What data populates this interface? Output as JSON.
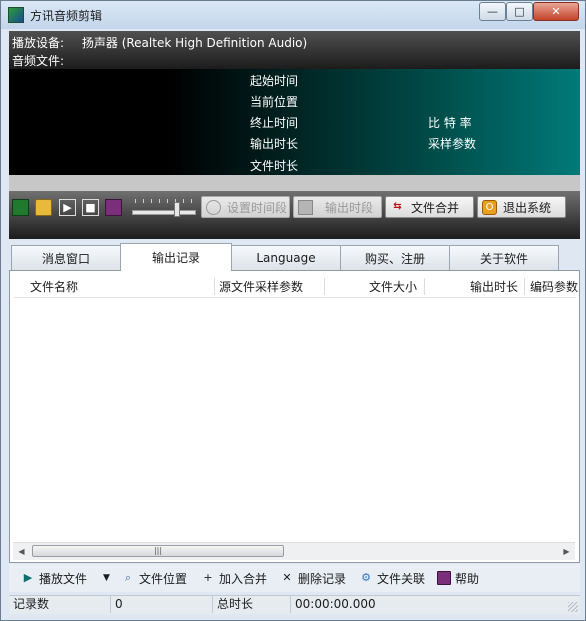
{
  "window": {
    "title": "方讯音频剪辑",
    "controls": {
      "minimize": "—",
      "maximize": "□",
      "close": "✕"
    }
  },
  "info": {
    "device_label": "播放设备:",
    "device_value": "扬声器 (Realtek High Definition Audio)",
    "file_label": "音频文件:"
  },
  "display": {
    "start_time": "起始时间",
    "current_position": "当前位置",
    "end_time": "终止时间",
    "output_duration": "输出时长",
    "file_duration": "文件时长",
    "bitrate": "比 特 率",
    "sample_params": "采样参数"
  },
  "toolbar": {
    "icons": [
      "record-icon",
      "open-folder-icon",
      "play-icon",
      "stop-icon",
      "book-icon"
    ],
    "volume_level": 0.75,
    "set_segment": "设置时间段",
    "output_segment": "输出时段",
    "merge_files": "文件合并",
    "exit": "退出系统"
  },
  "tabs": [
    {
      "label": "消息窗口",
      "active": false
    },
    {
      "label": "输出记录",
      "active": true
    },
    {
      "label": "Language",
      "active": false
    },
    {
      "label": "购买、注册",
      "active": false
    },
    {
      "label": "关于软件",
      "active": false
    }
  ],
  "table": {
    "columns": [
      "文件名称",
      "源文件采样参数",
      "文件大小",
      "输出时长",
      "编码参数"
    ],
    "rows": []
  },
  "bottom": {
    "play_file": "播放文件",
    "file_location": "文件位置",
    "add_merge": "加入合并",
    "delete_record": "删除记录",
    "file_assoc": "文件关联",
    "help": "帮助"
  },
  "status": {
    "record_count_label": "记录数",
    "record_count": "0",
    "total_duration_label": "总时长",
    "total_duration": "00:00:00.000"
  },
  "colors": {
    "display_gradient_end": "#007a78",
    "titlebar": "#c2d5ea"
  }
}
